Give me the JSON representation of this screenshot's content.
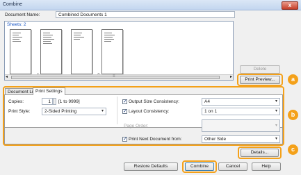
{
  "window": {
    "title": "Combine",
    "close_glyph": "x"
  },
  "document_name": {
    "label": "Document Name:",
    "value": "Combined Documents 1"
  },
  "sheets": {
    "label": "Sheets: 2",
    "group_numbers": [
      "1",
      "2"
    ]
  },
  "preview_buttons": {
    "delete": "Delete",
    "print_preview": "Print Preview..."
  },
  "tabs": [
    {
      "label": "Document List"
    },
    {
      "label": "Print Settings"
    }
  ],
  "settings": {
    "copies_label": "Copies:",
    "copies_value": "1",
    "copies_range": "[1 to 9999]",
    "print_style_label": "Print Style:",
    "print_style_value": "2-Sided Printing",
    "output_size_label": "Output Size Consistency:",
    "output_size_value": "A4",
    "output_size_checked": true,
    "layout_label": "Layout Consistency:",
    "layout_value": "1 on 1",
    "layout_checked": true,
    "page_order_label": "Page Order:",
    "page_order_value": "",
    "print_next_label": "Print Next Document from:",
    "print_next_value": "Other Side",
    "print_next_checked": true
  },
  "buttons": {
    "details": "Details...",
    "restore_defaults": "Restore Defaults",
    "combine": "Combine",
    "cancel": "Cancel",
    "help": "Help"
  },
  "callouts": [
    "a",
    "b",
    "c"
  ],
  "scrollbar": {
    "left_arrow": "◂",
    "right_arrow": "▸",
    "thumb_grip": "≡"
  },
  "icons": {
    "dropdown": "▾",
    "check": "✓"
  },
  "colors": {
    "callout": "#f4a11a",
    "sheets_label": "#1a56c4"
  }
}
